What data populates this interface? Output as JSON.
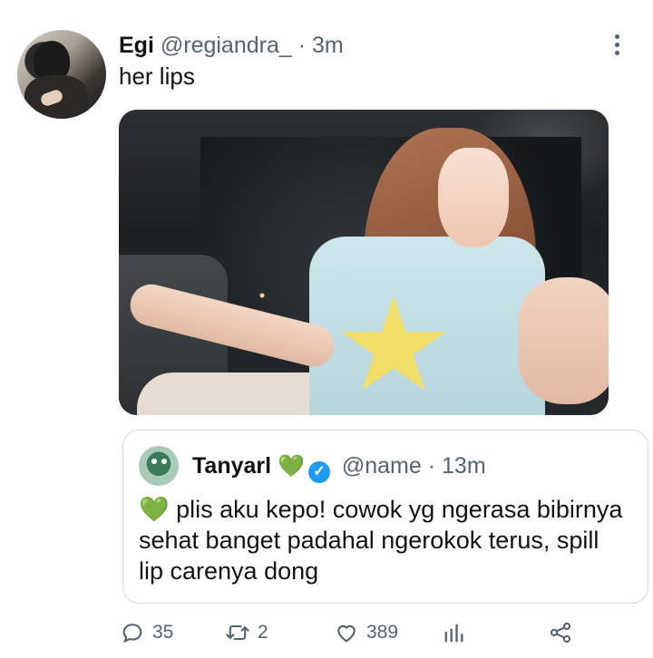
{
  "tweet": {
    "name": "Egi",
    "handle": "@regiandra_",
    "separator": "·",
    "time": "3m",
    "text": "her lips"
  },
  "quoted": {
    "name": "Tanyarl",
    "emoji": "💚",
    "handle": "@name",
    "separator": "·",
    "time": "13m",
    "text": "💚 plis aku kepo! cowok yg ngerasa bibirnya sehat banget padahal ngerokok terus, spill lip carenya dong"
  },
  "actions": {
    "replies": "35",
    "retweets": "2",
    "likes": "389"
  },
  "icons": [
    "more-vertical-icon",
    "reply-icon",
    "retweet-icon",
    "like-icon",
    "analytics-icon",
    "share-icon",
    "verified-badge-icon"
  ],
  "colors": {
    "text": "#0f1419",
    "secondary": "#536471",
    "border": "#cfd9de",
    "verified": "#1d9bf0"
  }
}
